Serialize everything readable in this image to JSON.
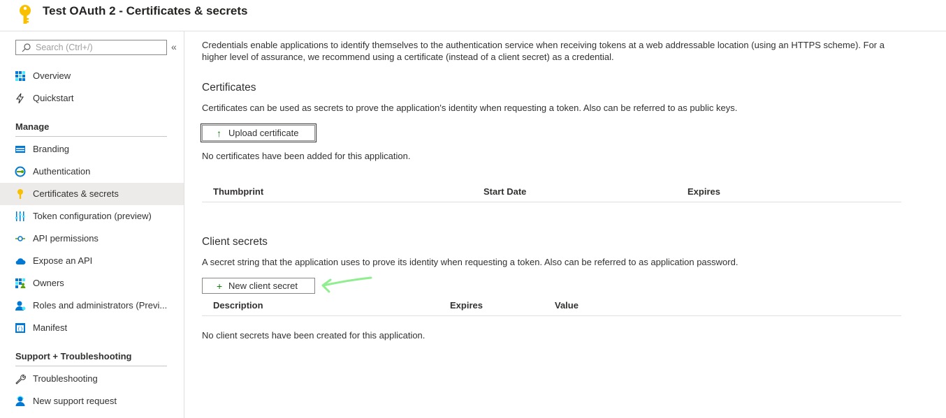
{
  "header": {
    "title": "Test OAuth 2 - Certificates & secrets",
    "icon": "key-icon",
    "icon_color": "#f8c000"
  },
  "sidebar": {
    "search": {
      "placeholder": "Search (Ctrl+/)"
    },
    "collapse_glyph": "«",
    "top_items": [
      {
        "label": "Overview",
        "icon": "overview-icon"
      },
      {
        "label": "Quickstart",
        "icon": "quickstart-icon"
      }
    ],
    "manage": {
      "heading": "Manage",
      "items": [
        {
          "label": "Branding",
          "icon": "branding-icon"
        },
        {
          "label": "Authentication",
          "icon": "authentication-icon"
        },
        {
          "label": "Certificates & secrets",
          "icon": "key-icon",
          "active": true
        },
        {
          "label": "Token configuration (preview)",
          "icon": "token-config-icon"
        },
        {
          "label": "API permissions",
          "icon": "api-permissions-icon"
        },
        {
          "label": "Expose an API",
          "icon": "cloud-icon"
        },
        {
          "label": "Owners",
          "icon": "owners-icon"
        },
        {
          "label": "Roles and administrators (Previ...",
          "icon": "roles-icon"
        },
        {
          "label": "Manifest",
          "icon": "manifest-icon"
        }
      ]
    },
    "support": {
      "heading": "Support + Troubleshooting",
      "items": [
        {
          "label": "Troubleshooting",
          "icon": "wrench-icon"
        },
        {
          "label": "New support request",
          "icon": "support-person-icon"
        }
      ]
    }
  },
  "main": {
    "intro": "Credentials enable applications to identify themselves to the authentication service when receiving tokens at a web addressable location (using an HTTPS scheme). For a higher level of assurance, we recommend using a certificate (instead of a client secret) as a credential.",
    "certificates": {
      "title": "Certificates",
      "description": "Certificates can be used as secrets to prove the application's identity when requesting a token. Also can be referred to as public keys.",
      "upload_button": "Upload certificate",
      "upload_icon": "upload-arrow-icon",
      "empty_message": "No certificates have been added for this application.",
      "columns": [
        "Thumbprint",
        "Start Date",
        "Expires"
      ]
    },
    "client_secrets": {
      "title": "Client secrets",
      "description": "A secret string that the application uses to prove its identity when requesting a token. Also can be referred to as application password.",
      "new_button": "New client secret",
      "new_icon": "plus-icon",
      "columns": [
        "Description",
        "Expires",
        "Value"
      ],
      "empty_message": "No client secrets have been created for this application."
    },
    "annotation_arrow_color": "#90ee90",
    "accent_color": "#0078d4"
  }
}
